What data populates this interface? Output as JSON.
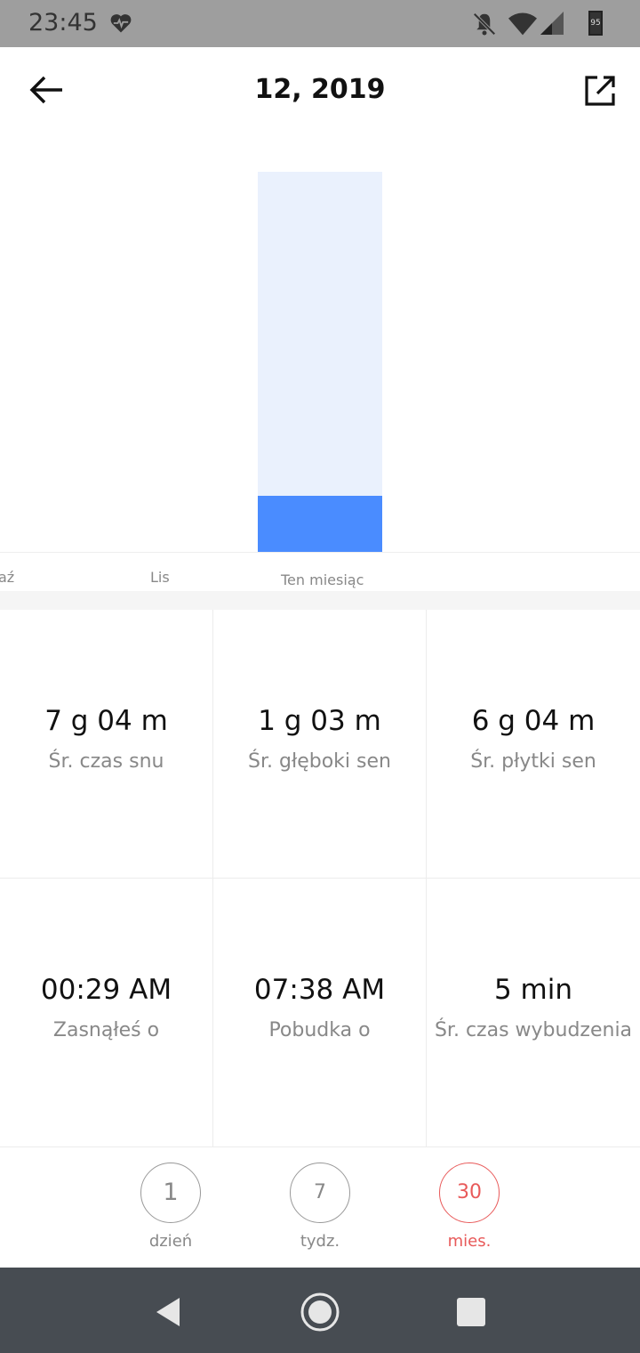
{
  "status": {
    "time": "23:45",
    "battery": "95",
    "icons": [
      "heart-rate-icon",
      "notifications-off-icon",
      "wifi-icon",
      "signal-icon",
      "battery-icon"
    ]
  },
  "header": {
    "title": "12, 2019",
    "back_icon": "arrow-left-icon",
    "share_icon": "share-icon"
  },
  "colors": {
    "accent": "#e85a5a",
    "deep_sleep": "#4a8cff",
    "light_sleep": "#eaf1fd",
    "navbar": "#474c52"
  },
  "chart_data": {
    "type": "bar",
    "stacked": true,
    "categories": [
      "aź",
      "Lis",
      "Ten miesiąc"
    ],
    "series": [
      {
        "values": [
          null,
          null,
          63
        ]
      },
      {
        "values": [
          null,
          null,
          364
        ]
      }
    ],
    "units": "minutes"
  },
  "stats": [
    {
      "value": "7 g 04 m",
      "label": "Śr. czas snu"
    },
    {
      "value": "1 g 03 m",
      "label": "Śr. głęboki sen"
    },
    {
      "value": "6 g 04 m",
      "label": "Śr. płytki sen"
    },
    {
      "value": "00:29 AM",
      "label": "Zasnąłeś o"
    },
    {
      "value": "07:38 AM",
      "label": "Pobudka o"
    },
    {
      "value": "5  min",
      "label": "Śr. czas wybudzenia"
    }
  ],
  "periods": [
    {
      "number": "1",
      "label": "dzień",
      "active": false
    },
    {
      "number": "7",
      "label": "tydz.",
      "active": false
    },
    {
      "number": "30",
      "label": "mies.",
      "active": true
    }
  ],
  "navigation": [
    "back-triangle-icon",
    "home-circle-icon",
    "recents-square-icon"
  ]
}
